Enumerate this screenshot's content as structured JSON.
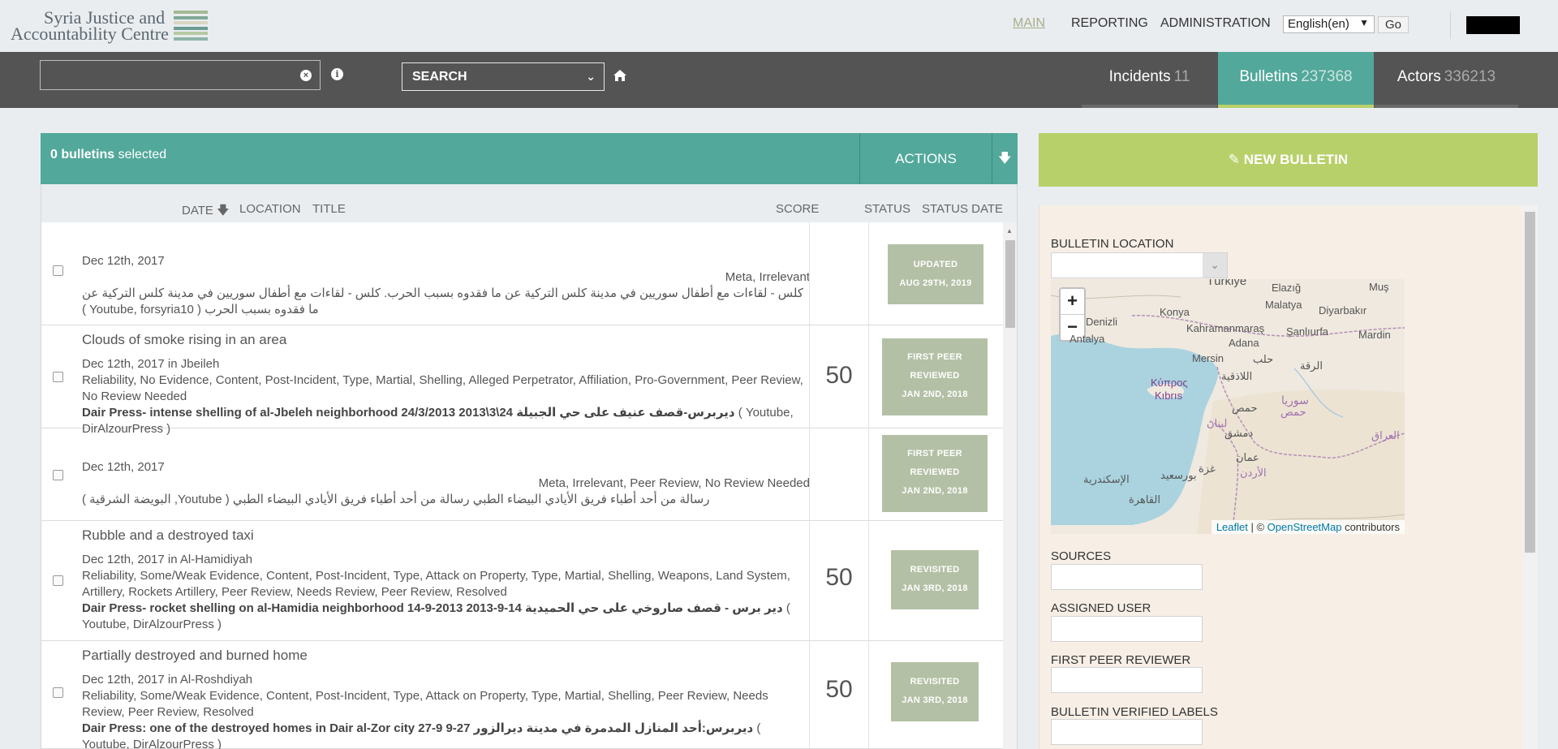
{
  "brand": {
    "line1": "Syria Justice and",
    "line2": "Accountability Centre",
    "stripe_colors": [
      "#a4b994",
      "#7fa997",
      "#d8d6c4",
      "#6c9d94",
      "#b7c9a2",
      "#8fb4a8"
    ]
  },
  "topnav": {
    "main": "MAIN",
    "reporting": "REPORTING",
    "administration": "ADMINISTRATION",
    "language": "English(en)",
    "go": "Go"
  },
  "toolbar": {
    "search_value": "",
    "search_type": "SEARCH",
    "tabs": [
      {
        "label": "Incidents",
        "count": "11",
        "active": false
      },
      {
        "label": "Bulletins",
        "count": "237368",
        "active": true
      },
      {
        "label": "Actors",
        "count": "336213",
        "active": false
      }
    ]
  },
  "selection": {
    "count_text": "0 bulletins",
    "suffix": "selected",
    "actions": "ACTIONS"
  },
  "columns": {
    "date": "DATE",
    "location": "LOCATION",
    "title": "TITLE",
    "score": "SCORE",
    "status": "STATUS",
    "status_date": "STATUS DATE"
  },
  "bulletins": [
    {
      "title": "",
      "date_line": "Dec 12th, 2017",
      "labels": "Meta, Irrelevant",
      "source_title": "",
      "source_text": "كلس - لقاءات مع أطفال سوريين في مدينة كلس التركية عن ما فقدوه بسبب الحرب. كلس - لقاءات مع أطفال سوريين في مدينة كلس التركية عن ما فقدوه بسبب الحرب ( Youtube, forsyria10 )",
      "score": "",
      "status_lines": [
        "UPDATED",
        "AUG 29TH, 2019"
      ]
    },
    {
      "title": "Clouds of smoke rising in an area",
      "date_line": "Dec 12th, 2017 in Jbeileh",
      "labels": "Reliability, No Evidence, Content, Post-Incident, Type, Martial, Shelling, Alleged Perpetrator, Affiliation, Pro-Government, Peer Review, No Review Needed",
      "source_title": "Dair Press- intense shelling of al-Jbeleh neighborhood 24/3/2013 2013\\3\\24 ديربرس-قصف عنيف على حي الجبيلة",
      "source_text": "( Youtube, DirAlzourPress )",
      "score": "50",
      "status_lines": [
        "FIRST PEER",
        "REVIEWED",
        "JAN 2ND, 2018"
      ]
    },
    {
      "title": "",
      "date_line": "Dec 12th, 2017",
      "labels": "Meta, Irrelevant, Peer Review, No Review Needed",
      "source_title": "",
      "source_text": "رسالة من أحد أطباء فريق الأيادي البيضاء الطبي رسالة من أحد أطباء فريق الأيادي البيضاء الطبي ( Youtube, البويضة الشرقية )",
      "score": "",
      "status_lines": [
        "FIRST PEER",
        "REVIEWED",
        "JAN 2ND, 2018"
      ]
    },
    {
      "title": "Rubble and a destroyed taxi",
      "date_line": "Dec 12th, 2017 in Al-Hamidiyah",
      "labels": "Reliability, Some/Weak Evidence, Content, Post-Incident, Type, Attack on Property, Type, Martial, Shelling, Weapons, Land System, Artillery, Rockets Artillery, Peer Review, Needs Review, Peer Review, Resolved",
      "source_title": "Dair Press- rocket shelling on al-Hamidia neighborhood 14-9-2013 2013-9-14 دير برس - قصف صاروخي على حي الحميدية",
      "source_text": "( Youtube, DirAlzourPress )",
      "score": "50",
      "status_lines": [
        "REVISITED",
        "JAN 3RD, 2018"
      ]
    },
    {
      "title": "Partially destroyed and burned home",
      "date_line": "Dec 12th, 2017 in Al-Roshdiyah",
      "labels": "Reliability, Some/Weak Evidence, Content, Post-Incident, Type, Attack on Property, Type, Martial, Shelling, Peer Review, Needs Review, Peer Review, Resolved",
      "source_title": "Dair Press: one of the destroyed homes in Dair al-Zor city 27-9 9-27 ديربرس:أحد المنازل المدمرة في مدينة ديرالزور",
      "source_text": "( Youtube, DirAlzourPress )",
      "score": "50",
      "status_lines": [
        "REVISITED",
        "JAN 3RD, 2018"
      ]
    }
  ],
  "new_bulletin": "NEW BULLETIN",
  "side": {
    "location_label": "BULLETIN LOCATION",
    "sources_label": "SOURCES",
    "assigned_label": "ASSIGNED USER",
    "peer_label": "FIRST PEER REVIEWER",
    "verified_label": "BULLETIN VERIFIED LABELS"
  },
  "map": {
    "attribution_leaflet": "Leaflet",
    "attribution_sep": " | © ",
    "attribution_osm": "OpenStreetMap",
    "attribution_tail": " contributors",
    "zoom_in": "+",
    "zoom_out": "−",
    "places": [
      {
        "name": "Türkiye"
      },
      {
        "name": "Elazığ"
      },
      {
        "name": "Muş"
      },
      {
        "name": "Malatya"
      },
      {
        "name": "Diyarbakır"
      },
      {
        "name": "Konya"
      },
      {
        "name": "Denizli"
      },
      {
        "name": "Kahramanmaraş"
      },
      {
        "name": "Şanlıurfa"
      },
      {
        "name": "Mardin"
      },
      {
        "name": "Antalya"
      },
      {
        "name": "Adana"
      },
      {
        "name": "Mersin"
      },
      {
        "name": "حلب"
      },
      {
        "name": "الرقة"
      },
      {
        "name": "اللاذقية"
      },
      {
        "name": "Κύπρος"
      },
      {
        "name": "Kıbrıs"
      },
      {
        "name": "سوريا"
      },
      {
        "name": "حمص"
      },
      {
        "name": "حمص"
      },
      {
        "name": "لبنان"
      },
      {
        "name": "دمشق"
      },
      {
        "name": "العراق"
      },
      {
        "name": "عمان"
      },
      {
        "name": "الأردن"
      },
      {
        "name": "غزة"
      },
      {
        "name": "بورسعيد"
      },
      {
        "name": "الإسكندرية"
      },
      {
        "name": "القاهرة"
      }
    ]
  }
}
